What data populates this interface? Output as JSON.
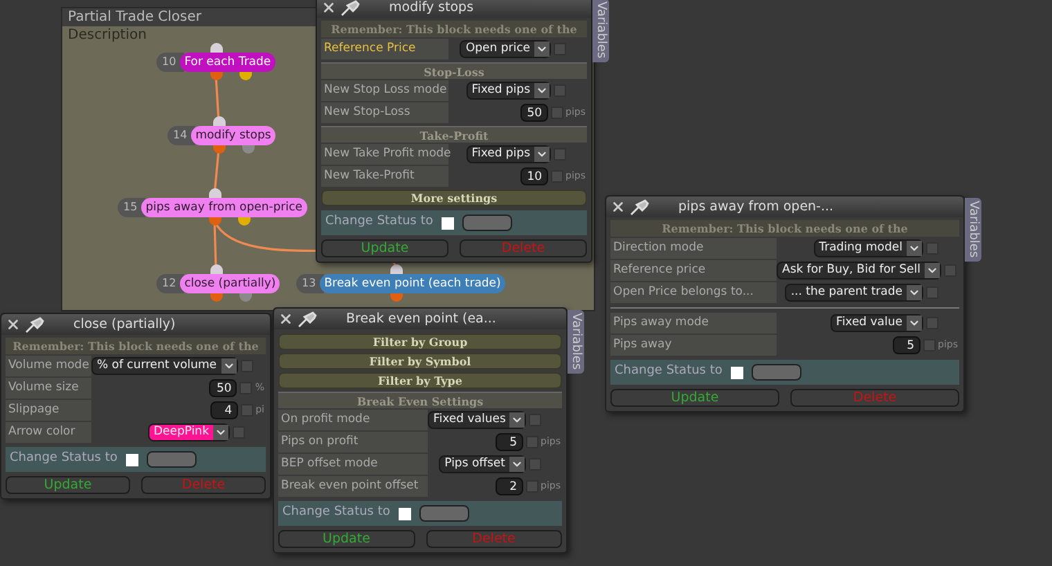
{
  "canvas": {
    "title": "Partial Trade Closer",
    "description": "Description",
    "tree": [
      {
        "number": "10",
        "label": "For each Trade",
        "color": "#c010c0",
        "ports": [
          {
            "color": "#e0b000"
          }
        ],
        "children": [
          {
            "number": "14",
            "label": "modify stops",
            "color": "#f080f0",
            "ports": [
              {
                "color": "#8a8a8a"
              }
            ],
            "children": [
              {
                "number": "15",
                "label": "pips away from open-price",
                "color": "#f080f0",
                "ports": [
                  {
                    "color": "#e0b000"
                  }
                ],
                "children": [
                  {
                    "number": "12",
                    "label": "close (partially)",
                    "color": "#f080f0",
                    "ports": [
                      {
                        "color": "#8a8a8a"
                      }
                    ]
                  },
                  {
                    "number": "13",
                    "label": "Break even point (each trade)",
                    "color": "#3f7fb8"
                  }
                ]
              }
            ]
          }
        ]
      }
    ]
  },
  "panels": [
    {
      "title": "modify stops",
      "tab": "Variables",
      "rows": [
        {
          "kind": "note",
          "text": "Remember: This block needs one of the"
        },
        {
          "kind": "select",
          "label": "Reference Price",
          "value": "Open price",
          "highlighted": true,
          "checked": false
        },
        {
          "kind": "section",
          "text": "Stop-Loss"
        },
        {
          "kind": "select",
          "label": "New Stop Loss mode",
          "value": "Fixed pips",
          "highlighted": false,
          "checked": false
        },
        {
          "kind": "number",
          "label": "New Stop-Loss",
          "value": "50",
          "unit": "pips",
          "highlighted": false,
          "checked": false
        },
        {
          "kind": "section",
          "text": "Take-Profit"
        },
        {
          "kind": "select",
          "label": "New Take Profit mode",
          "value": "Fixed pips",
          "highlighted": false,
          "checked": false
        },
        {
          "kind": "number",
          "label": "New Take-Profit",
          "value": "10",
          "unit": "pips",
          "highlighted": false,
          "checked": false
        },
        {
          "kind": "bar",
          "text": "More settings"
        }
      ],
      "status_label": "Change Status to",
      "status_checked": false,
      "update": "Update",
      "delete": "Delete"
    },
    {
      "title": "pips away from open-...",
      "tab": "Variables",
      "rows": [
        {
          "kind": "note",
          "text": "Remember: This block needs one of the"
        },
        {
          "kind": "select",
          "label": "Direction mode",
          "value": "Trading model",
          "checked": false
        },
        {
          "kind": "select",
          "label": "Reference price",
          "value": "Ask for Buy, Bid for Sell",
          "checked": false
        },
        {
          "kind": "select",
          "label": "Open Price belongs to...",
          "value": "... the parent trade",
          "checked": false
        },
        {
          "kind": "divider"
        },
        {
          "kind": "select",
          "label": "Pips away mode",
          "value": "Fixed value",
          "checked": false
        },
        {
          "kind": "number",
          "label": "Pips away",
          "value": "5",
          "unit": "pips",
          "checked": false
        }
      ],
      "status_label": "Change Status to",
      "status_checked": false,
      "update": "Update",
      "delete": "Delete"
    },
    {
      "title": "close (partially)",
      "rows": [
        {
          "kind": "note",
          "text": "Remember: This block needs one of the"
        },
        {
          "kind": "select",
          "label": "Volume mode",
          "value": "% of current volume",
          "checked": false
        },
        {
          "kind": "number",
          "label": "Volume size",
          "value": "50",
          "unit": "%",
          "checked": false
        },
        {
          "kind": "number",
          "label": "Slippage",
          "value": "4",
          "unit": "pi",
          "checked": false
        },
        {
          "kind": "select",
          "label": "Arrow color",
          "value": "DeepPink",
          "color": "#ff1493",
          "checked": false
        }
      ],
      "status_label": "Change Status to",
      "status_checked": false,
      "update": "Update",
      "delete": "Delete"
    },
    {
      "title": "Break even point (ea...",
      "tab": "Variables",
      "rows": [
        {
          "kind": "bar",
          "text": "Filter by Group"
        },
        {
          "kind": "bar",
          "text": "Filter by Symbol"
        },
        {
          "kind": "bar",
          "text": "Filter by Type"
        },
        {
          "kind": "section",
          "text": "Break Even Settings"
        },
        {
          "kind": "select",
          "label": "On profit mode",
          "value": "Fixed values",
          "checked": false
        },
        {
          "kind": "number",
          "label": "Pips on profit",
          "value": "5",
          "unit": "pips",
          "checked": false
        },
        {
          "kind": "select",
          "label": "BEP offset mode",
          "value": "Pips offset",
          "checked": false
        },
        {
          "kind": "number",
          "label": "Break even point offset",
          "value": "2",
          "unit": "pips",
          "checked": false
        }
      ],
      "status_label": "Change Status to",
      "status_checked": false,
      "update": "Update",
      "delete": "Delete"
    }
  ]
}
